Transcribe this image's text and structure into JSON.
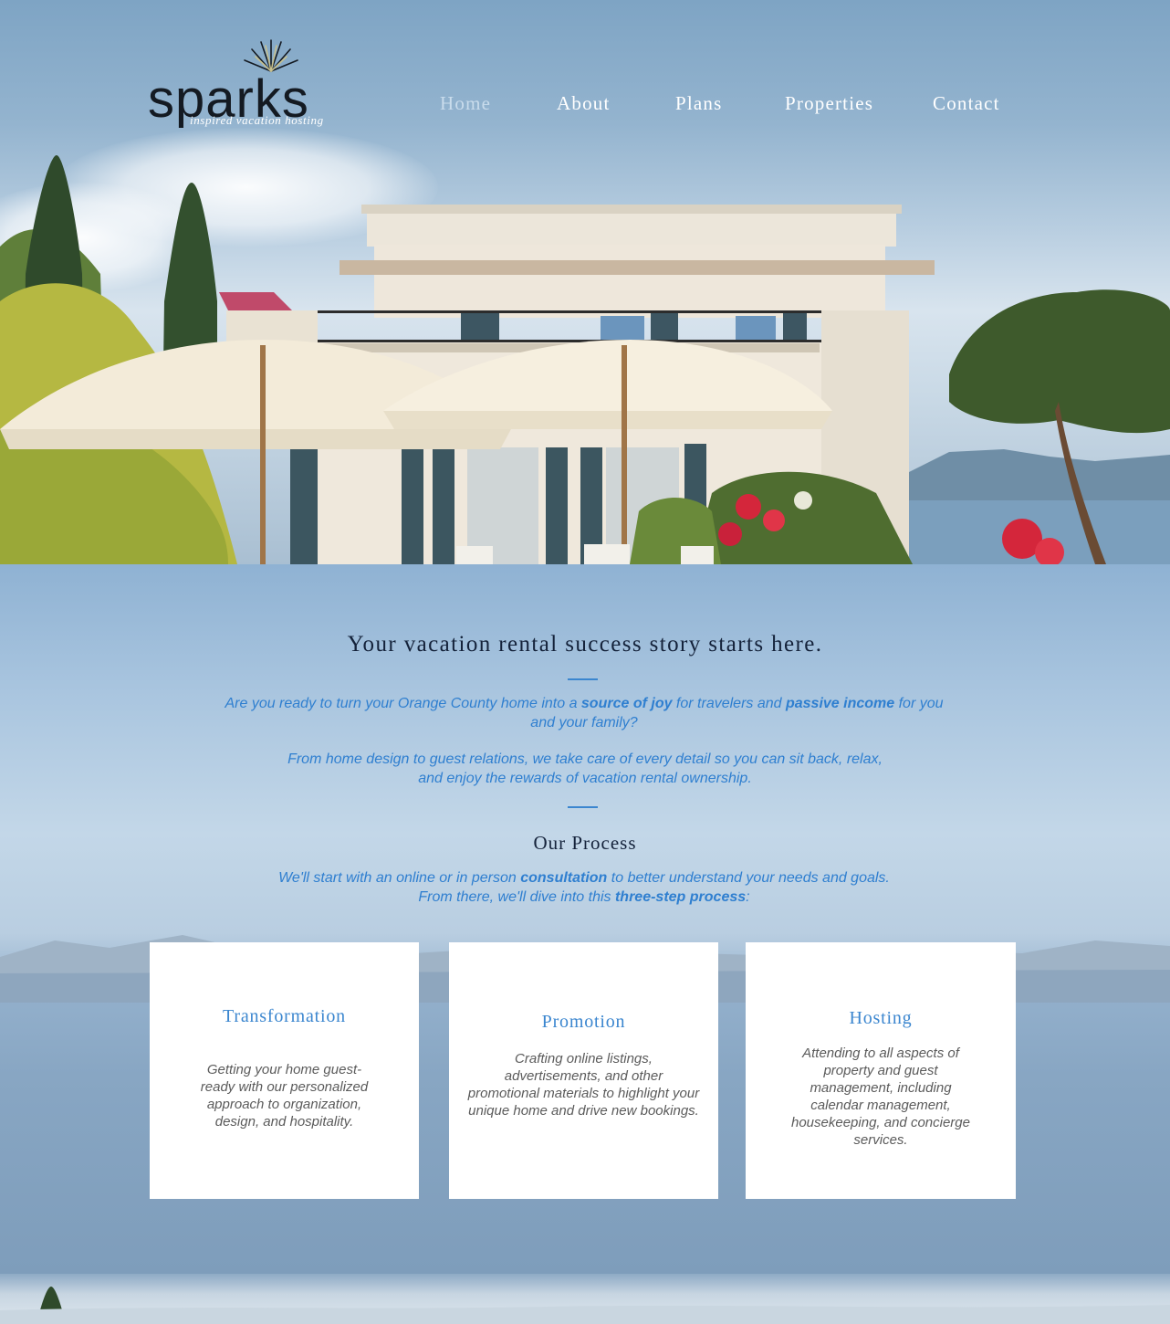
{
  "brand": {
    "logo_text": "sparks",
    "tagline": "inspired vacation hosting"
  },
  "nav": {
    "items": [
      {
        "label": "Home",
        "active": true
      },
      {
        "label": "About",
        "active": false
      },
      {
        "label": "Plans",
        "active": false
      },
      {
        "label": "Properties",
        "active": false
      },
      {
        "label": "Contact",
        "active": false
      }
    ]
  },
  "intro": {
    "headline": "Your vacation rental success story starts here.",
    "p1_a": "Are you ready to turn your Orange County home into a ",
    "p1_b": "source of joy",
    "p1_c": " for travelers and ",
    "p1_d": "passive income",
    "p1_e": " for you and your family?",
    "p2": "From home design to guest relations, we take care of every detail so you can sit back, relax, and enjoy the rewards of vacation rental ownership."
  },
  "process": {
    "title": "Our Process",
    "p_a": "We'll start with an online or in person ",
    "p_b": "consultation",
    "p_c": " to better understand your needs and goals.",
    "p_d": "From there, we'll dive into this ",
    "p_e": "three-step process",
    "p_f": ":",
    "cards": [
      {
        "title": "Transformation",
        "text": "Getting your home guest-ready with our personalized approach to organization, design, and hospitality."
      },
      {
        "title": "Promotion",
        "text": "Crafting online listings, advertisements, and other promotional materials to highlight your unique home and drive new bookings."
      },
      {
        "title": "Hosting",
        "text": "Attending to all aspects of property and guest management, including calendar management, housekeeping, and concierge services."
      }
    ]
  },
  "colors": {
    "accent": "#3b86cf",
    "heading": "#14223a",
    "body_text": "#5b5b5b",
    "nav_active": "#c9dcec"
  }
}
